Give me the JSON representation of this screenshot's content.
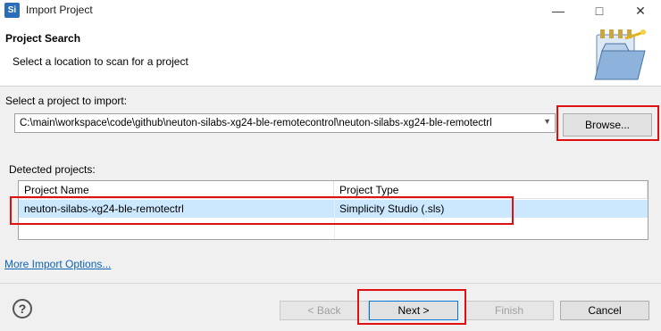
{
  "window": {
    "title": "Import Project",
    "app_icon": "Si"
  },
  "header": {
    "title": "Project Search",
    "description": "Select a location to scan for a project"
  },
  "project_select": {
    "label": "Select a project to import:",
    "path": "C:\\main\\workspace\\code\\github\\neuton-silabs-xg24-ble-remotecontrol\\neuton-silabs-xg24-ble-remotectrl",
    "browse_label": "Browse..."
  },
  "detected": {
    "label": "Detected projects:",
    "columns": [
      "Project Name",
      "Project Type"
    ],
    "rows": [
      [
        "neuton-silabs-xg24-ble-remotectrl",
        "Simplicity Studio (.sls)"
      ]
    ]
  },
  "more_options_label": "More Import Options...",
  "footer": {
    "back_label": "< Back",
    "next_label": "Next >",
    "finish_label": "Finish",
    "cancel_label": "Cancel"
  },
  "icons": {
    "help": "help-icon",
    "minimize": "minimize-icon",
    "maximize": "maximize-icon",
    "close": "close-icon"
  },
  "colors": {
    "highlight_box": "#e01010",
    "selected_row": "#cce8ff",
    "link": "#0e63b5"
  }
}
